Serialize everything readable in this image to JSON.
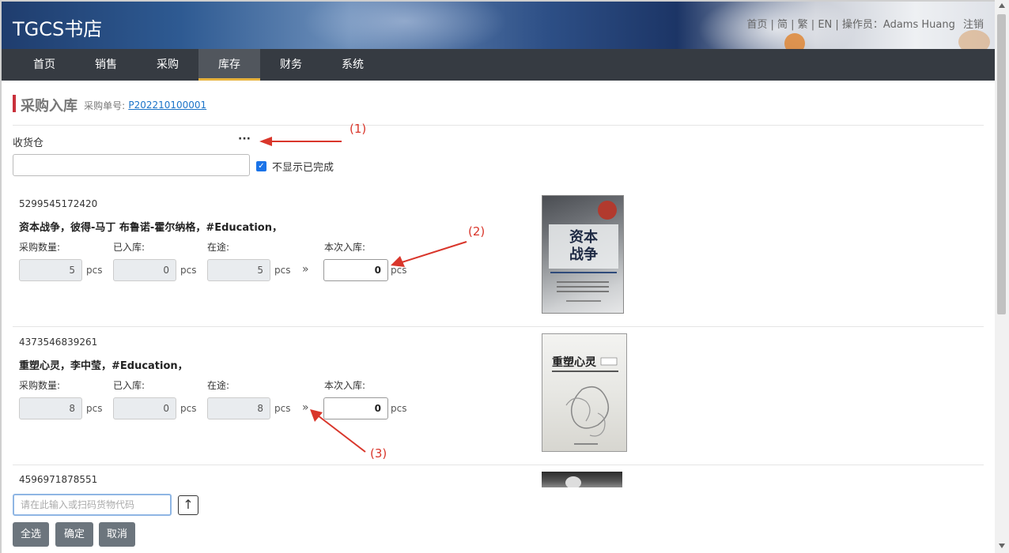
{
  "header": {
    "brand": "TGCS书店",
    "links": "首页 | 简 | 繁 | EN | 操作员：Adams Huang",
    "logout": "注销"
  },
  "nav": [
    "首页",
    "销售",
    "采购",
    "库存",
    "财务",
    "系统"
  ],
  "nav_active": "库存",
  "page": {
    "title": "采购入库",
    "order_label": "采购单号:",
    "order_no": "P202210100001"
  },
  "warehouse": {
    "label": "收货仓",
    "more": "···",
    "value": "",
    "hide_done_label": "不显示已完成",
    "hide_done_checked": true
  },
  "field_labels": {
    "ordered": "采购数量:",
    "received": "已入库:",
    "transit": "在途:",
    "this_time": "本次入库:",
    "unit": "pcs"
  },
  "items": [
    {
      "code": "5299545172420",
      "name": "资本战争，彼得-马丁 布鲁诺-霍尔纳格，#Education，",
      "ordered": "5",
      "received": "0",
      "transit": "5",
      "this_time": "0"
    },
    {
      "code": "4373546839261",
      "name": "重塑心灵，李中莹，#Education，",
      "ordered": "8",
      "received": "0",
      "transit": "8",
      "this_time": "0"
    },
    {
      "code": "4596971878551"
    }
  ],
  "annotations": [
    "(1)",
    "(2)",
    "(3)"
  ],
  "scan": {
    "placeholder": "请在此输入或扫码货物代码"
  },
  "buttons": {
    "select_all": "全选",
    "confirm": "确定",
    "cancel": "取消"
  },
  "colors": {
    "accent_red": "#c9303b",
    "nav_bg": "#363b42",
    "nav_active_underline": "#e8b23c",
    "link": "#1a73c8",
    "annotation": "#d9362b"
  }
}
